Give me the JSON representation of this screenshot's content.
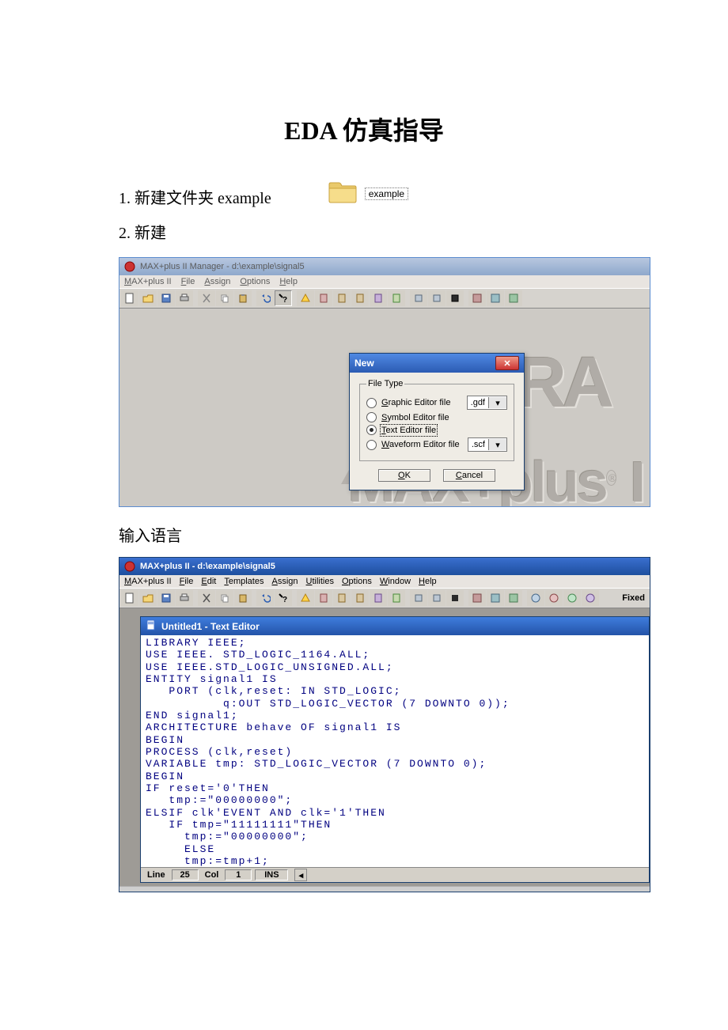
{
  "title": "EDA 仿真指导",
  "step1": "1. 新建文件夹 example",
  "folder_label": "example",
  "step2": "2. 新建",
  "caption_input": "输入语言",
  "win1": {
    "title_path": "MAX+plus II Manager - d:\\example\\signal5",
    "menus": [
      "MAX+plus II",
      "File",
      "Assign",
      "Options",
      "Help"
    ],
    "watermark_1": "A",
    "watermark_2": "MAX+plus",
    "watermark_r": "®",
    "watermark_tail": "I",
    "dialog": {
      "title": "New",
      "group": "File Type",
      "opts": [
        {
          "label": "Graphic Editor file",
          "ext": ".gdf",
          "selected": false,
          "has_ext": true
        },
        {
          "label": "Symbol Editor file",
          "ext": "",
          "selected": false,
          "has_ext": false
        },
        {
          "label": "Text Editor file",
          "ext": "",
          "selected": true,
          "has_ext": false
        },
        {
          "label": "Waveform Editor file",
          "ext": ".scf",
          "selected": false,
          "has_ext": true
        }
      ],
      "ok": "OK",
      "cancel": "Cancel"
    }
  },
  "win2": {
    "title_path": "MAX+plus II - d:\\example\\signal5",
    "menus": [
      "MAX+plus II",
      "File",
      "Edit",
      "Templates",
      "Assign",
      "Utilities",
      "Options",
      "Window",
      "Help"
    ],
    "fixed_label": "Fixed",
    "inner_title": "Untitled1 - Text Editor",
    "code": "LIBRARY IEEE;\nUSE IEEE. STD_LOGIC_1164.ALL;\nUSE IEEE.STD_LOGIC_UNSIGNED.ALL;\nENTITY signal1 IS\n   PORT (clk,reset: IN STD_LOGIC;\n          q:OUT STD_LOGIC_VECTOR (7 DOWNTO 0));\nEND signal1;\nARCHITECTURE behave OF signal1 IS\nBEGIN\nPROCESS (clk,reset)\nVARIABLE tmp: STD_LOGIC_VECTOR (7 DOWNTO 0);\nBEGIN\nIF reset='0'THEN\n   tmp:=\"00000000\";\nELSIF clk'EVENT AND clk='1'THEN\n   IF tmp=\"11111111\"THEN\n     tmp:=\"00000000\";\n     ELSE\n     tmp:=tmp+1;",
    "status": {
      "line_lbl": "Line",
      "line": "25",
      "col_lbl": "Col",
      "col": "1",
      "ins": "INS"
    }
  }
}
